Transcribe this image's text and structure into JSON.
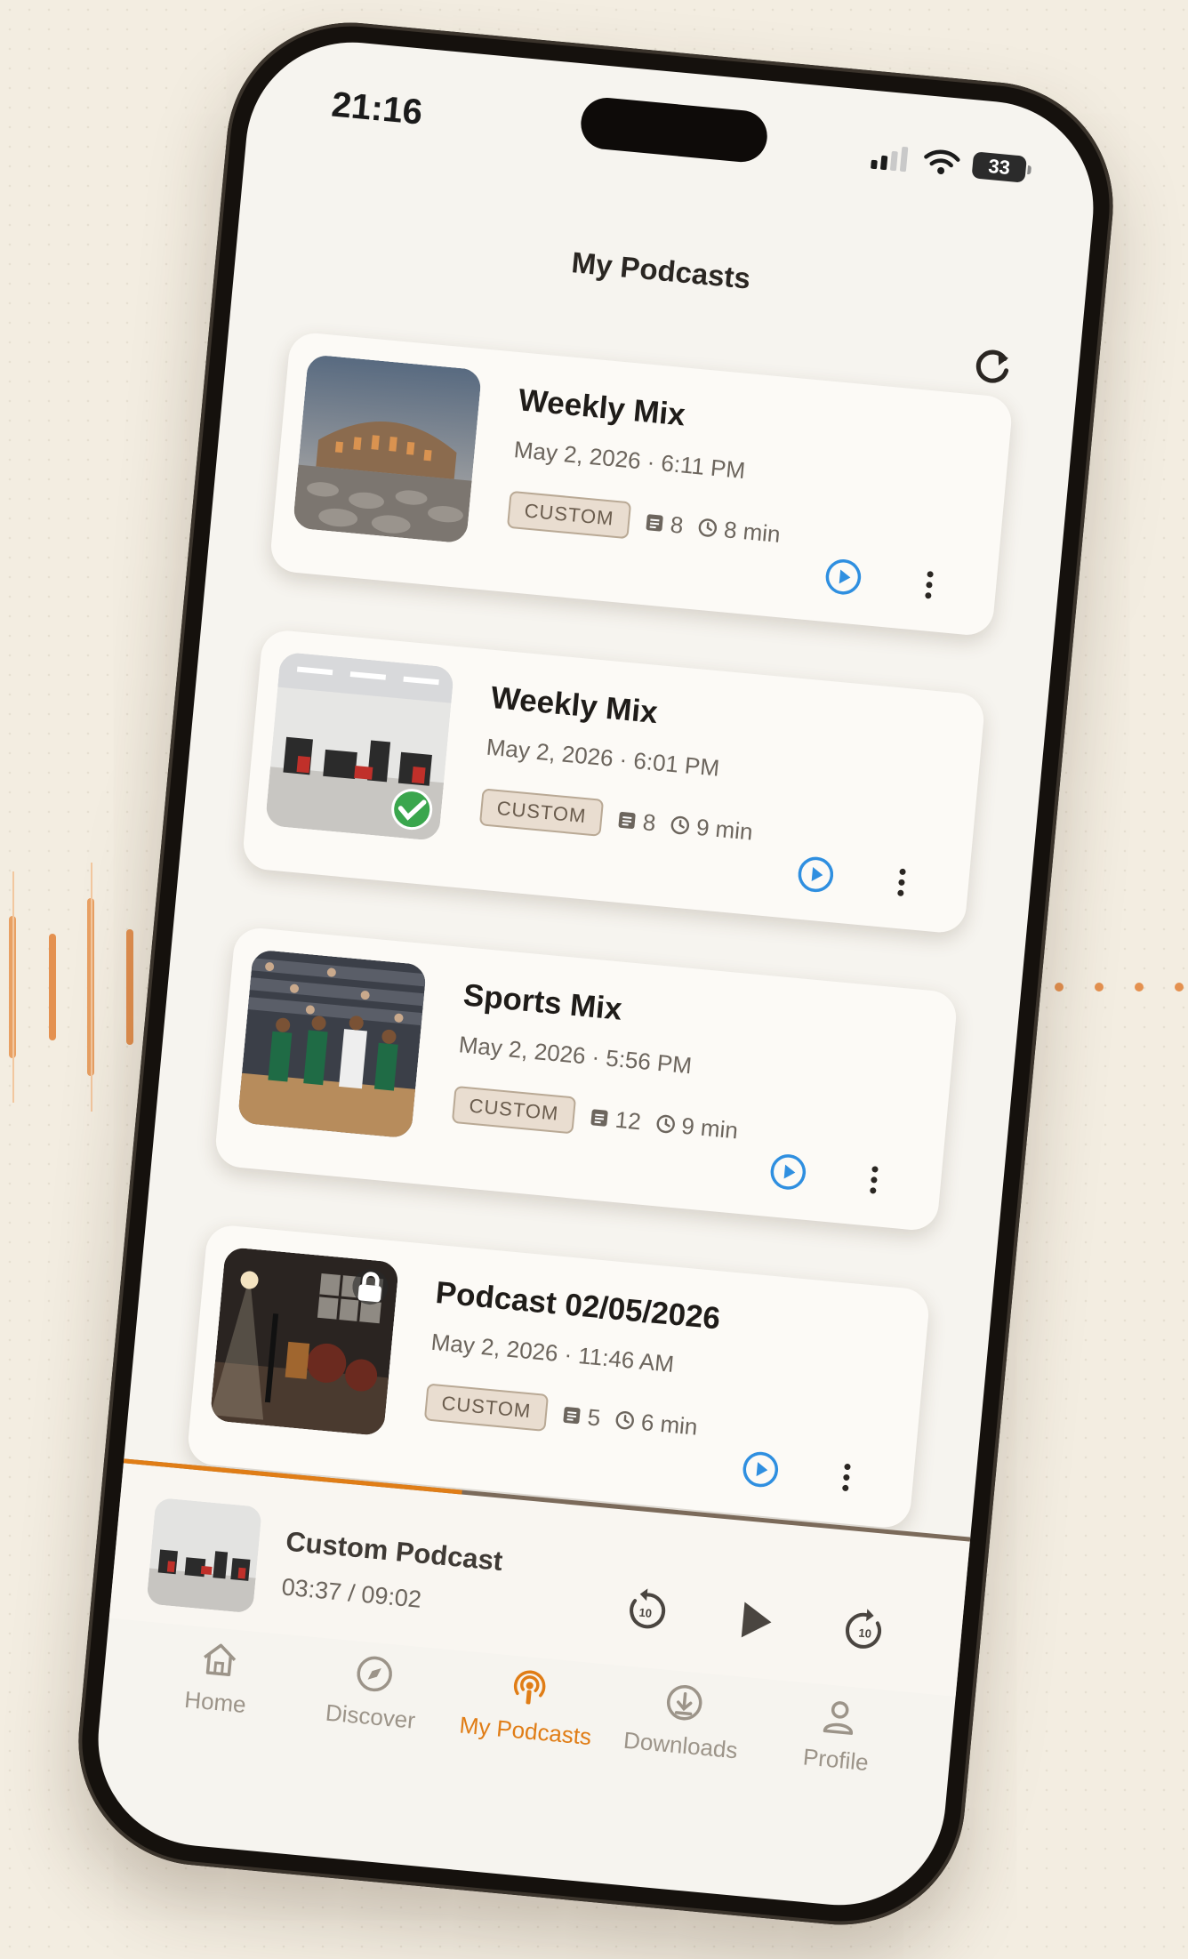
{
  "status_bar": {
    "time": "21:16",
    "battery": "33"
  },
  "header": {
    "title": "My Podcasts"
  },
  "podcasts": [
    {
      "title": "Weekly Mix",
      "date": "May 2, 2026 · 6:11 PM",
      "tag": "CUSTOM",
      "count": "8",
      "duration": "8 min",
      "thumb_icon": "colosseum-photo"
    },
    {
      "title": "Weekly Mix",
      "date": "May 2, 2026 · 6:01 PM",
      "tag": "CUSTOM",
      "count": "8",
      "duration": "9 min",
      "thumb_icon": "gym-photo",
      "downloaded": true
    },
    {
      "title": "Sports Mix",
      "date": "May 2, 2026 · 5:56 PM",
      "tag": "CUSTOM",
      "count": "12",
      "duration": "9 min",
      "thumb_icon": "basketball-photo"
    },
    {
      "title": "Podcast 02/05/2026",
      "date": "May 2, 2026 · 11:46 AM",
      "tag": "CUSTOM",
      "count": "5",
      "duration": "6 min",
      "thumb_icon": "studio-photo",
      "locked": true
    }
  ],
  "player": {
    "title": "Custom Podcast",
    "time": "03:37 / 09:02",
    "progress": 0.4,
    "skip_back": "10",
    "skip_forward": "10"
  },
  "tabs": [
    {
      "label": "Home",
      "icon": "home-icon"
    },
    {
      "label": "Discover",
      "icon": "compass-icon"
    },
    {
      "label": "My Podcasts",
      "icon": "podcast-icon",
      "active": true
    },
    {
      "label": "Downloads",
      "icon": "download-icon"
    },
    {
      "label": "Profile",
      "icon": "profile-icon"
    }
  ],
  "colors": {
    "accent": "#e07d16",
    "play": "#2f8fe0",
    "background": "#f3ede1"
  }
}
